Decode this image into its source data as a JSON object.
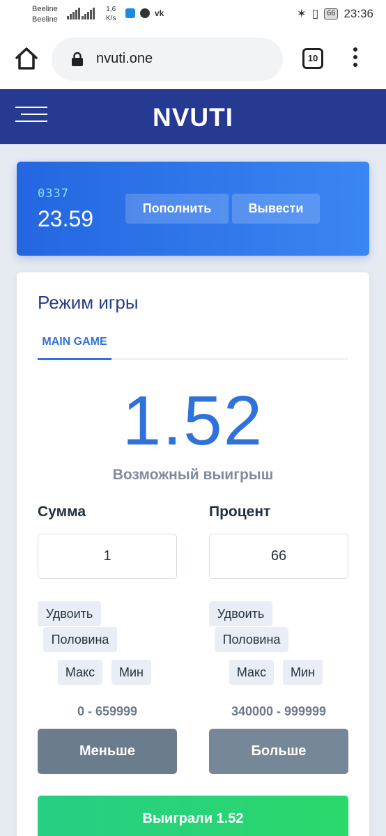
{
  "status_bar": {
    "carrier_1": "Beeline",
    "carrier_2": "Beeline",
    "speed_value": "1,6",
    "speed_unit": "K/s",
    "battery": "66",
    "time": "23:36"
  },
  "browser": {
    "url": "nvuti.one",
    "tab_count": "10"
  },
  "site": {
    "logo": "NVUTI"
  },
  "balance_card": {
    "account_id": "0337",
    "balance": "23.59",
    "deposit_label": "Пополнить",
    "withdraw_label": "Вывести"
  },
  "game": {
    "title": "Режим игры",
    "tab_label": "MAIN GAME",
    "possible_win_value": "1.52",
    "possible_win_label": "Возможный выигрыш",
    "sum": {
      "label": "Сумма",
      "value": "1",
      "double_label": "Удвоить",
      "half_label": "Половина",
      "max_label": "Макс",
      "min_label": "Мин",
      "range": "0 - 659999",
      "action_label": "Меньше"
    },
    "percent": {
      "label": "Процент",
      "value": "66",
      "double_label": "Удвоить",
      "half_label": "Половина",
      "max_label": "Макс",
      "min_label": "Мин",
      "range": "340000 - 999999",
      "action_label": "Больше"
    },
    "result_label": "Выиграли 1.52"
  },
  "colors": {
    "header": "#263a91",
    "accent": "#2f72d9",
    "success": "#25cf84"
  }
}
